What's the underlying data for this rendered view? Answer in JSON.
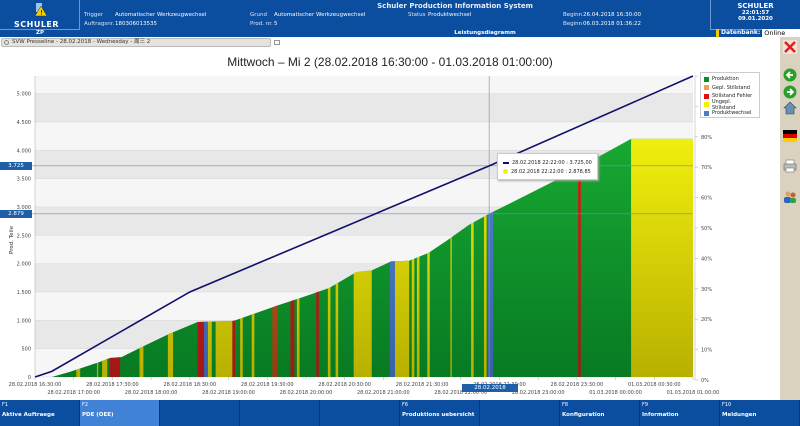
{
  "header": {
    "title": "Schuler Production Information System",
    "logo": "SCHULER",
    "fields": [
      {
        "label": "Trigger",
        "value": "Automatischer Werkzeugwechsel"
      },
      {
        "label": "Auftragsnr.",
        "value": "180306013535"
      },
      {
        "label": "Grund",
        "value": "Automatischer Werkzeugwechsel"
      },
      {
        "label": "Prod. nr.",
        "value": "5"
      },
      {
        "label": "Status",
        "value": "Produktwechsel"
      },
      {
        "label": "Beginn",
        "value": "26.04.2018 16:30:00"
      },
      {
        "label": "Beginn",
        "value": "06.03.2018 01:36:22"
      }
    ],
    "right_logo": "SCHULER",
    "time": "22:01:57",
    "date": "09.01.2020",
    "zp": "ZP",
    "view": "Leistungsdiagramm",
    "db_label": "Datenbank:",
    "db_value": "Online"
  },
  "tab": {
    "label": "SVW Presseline - 28.02.2018 - Wednesday - 周三 2"
  },
  "chart_title": "Mittwoch – Mi 2  (28.02.2018 16:30:00 - 01.03.2018 01:00:00)",
  "legend": [
    {
      "name": "Produktion",
      "color": "#0a8f2a"
    },
    {
      "name": "Gepl. Stillstand",
      "color": "#f0a050"
    },
    {
      "name": "Stillstand Fehler",
      "color": "#e01010"
    },
    {
      "name": "Ungepl. Stillstand",
      "color": "#f5f000"
    },
    {
      "name": "Produktwechsel",
      "color": "#4a7fc8"
    }
  ],
  "tooltip": [
    {
      "text": "28.02.2018 22:22:00 : 3.725,00",
      "color": "#10106a"
    },
    {
      "text": "28.02.2018 22:22:00 : 2.878,85",
      "color": "#f5f000"
    }
  ],
  "crosshair": {
    "y1_label": "3.725",
    "y2_label": "2.879",
    "x_label": "28.02.2018 22:22:00"
  },
  "chart_data": {
    "type": "area",
    "ylabel": "Prod. Teile",
    "start": "28.02.2018 16:30",
    "end": "01.03.2018 01:00",
    "ylim": [
      0,
      5310
    ],
    "y2lim": [
      0,
      100
    ],
    "yticks": [
      "0",
      "500",
      "1.000",
      "1.500",
      "2.000",
      "2.500",
      "3.000",
      "3.500",
      "4.000",
      "4.500",
      "5.000"
    ],
    "ytick_values": [
      0,
      500,
      1000,
      1500,
      2000,
      2500,
      3000,
      3500,
      4000,
      4500,
      5000
    ],
    "y2ticks": [
      "0%",
      "10%",
      "20%",
      "30%",
      "40%",
      "50%",
      "60%",
      "70%",
      "80%",
      "90%",
      "100%"
    ],
    "xticks_row1": [
      "28.02.2018 16:30:00",
      "28.02.2018 17:30:00",
      "28.02.2018 18:30:00",
      "28.02.2018 19:30:00",
      "28.02.2018 20:30:00",
      "28.02.2018 21:30:00",
      "28.02.2018 22:30:00",
      "28.02.2018 23:30:00",
      "01.03.2018 00:30:00"
    ],
    "xticks_row2": [
      "28.02.2018 17:00:00",
      "28.02.2018 18:00:00",
      "28.02.2018 19:00:00",
      "28.02.2018 20:00:00",
      "28.02.2018 21:00:00",
      "28.02.2018 22:00:00",
      "28.02.2018 23:00:00",
      "01.03.2018 00:00:00",
      "01.03.2018 01:00:00"
    ],
    "target_line": [
      [
        "28.02.2018 16:30",
        0
      ],
      [
        "28.02.2018 16:43",
        100
      ],
      [
        "28.02.2018 18:30",
        1500
      ],
      [
        "28.02.2018 22:22",
        3725
      ],
      [
        "01.03.2018 01:00",
        5310
      ]
    ],
    "produced": [
      [
        "28.02.2018 16:30",
        0
      ],
      [
        "28.02.2018 16:43",
        0
      ],
      [
        "28.02.2018 16:57",
        90
      ],
      [
        "28.02.2018 17:20",
        265
      ],
      [
        "28.02.2018 17:28",
        335
      ],
      [
        "28.02.2018 17:37",
        350
      ],
      [
        "28.02.2018 17:51",
        510
      ],
      [
        "28.02.2018 18:14",
        760
      ],
      [
        "28.02.2018 18:36",
        970
      ],
      [
        "28.02.2018 19:04",
        990
      ],
      [
        "28.02.2018 19:39",
        1270
      ],
      [
        "28.02.2018 19:55",
        1390
      ],
      [
        "28.02.2018 20:18",
        1570
      ],
      [
        "28.02.2018 20:39",
        1850
      ],
      [
        "28.02.2018 20:51",
        1880
      ],
      [
        "28.02.2018 21:06",
        2040
      ],
      [
        "28.02.2018 21:20",
        2050
      ],
      [
        "28.02.2018 21:35",
        2190
      ],
      [
        "28.02.2018 21:50",
        2420
      ],
      [
        "28.02.2018 22:06",
        2680
      ],
      [
        "28.02.2018 22:22",
        2879
      ],
      [
        "28.02.2018 23:11",
        3440
      ],
      [
        "01.03.2018 00:12",
        4200
      ],
      [
        "01.03.2018 01:00",
        4200
      ]
    ],
    "states": [
      [
        "28.02.2018 17:02",
        "28.02.2018 17:05",
        "Ungepl. Stillstand"
      ],
      [
        "28.02.2018 17:18",
        "28.02.2018 17:19",
        "Ungepl. Stillstand"
      ],
      [
        "28.02.2018 17:22",
        "28.02.2018 17:26",
        "Ungepl. Stillstand"
      ],
      [
        "28.02.2018 17:28",
        "28.02.2018 17:36",
        "Stillstand Fehler"
      ],
      [
        "28.02.2018 17:51",
        "28.02.2018 17:54",
        "Ungepl. Stillstand"
      ],
      [
        "28.02.2018 18:13",
        "28.02.2018 18:17",
        "Ungepl. Stillstand"
      ],
      [
        "28.02.2018 18:36",
        "28.02.2018 18:41",
        "Stillstand Fehler"
      ],
      [
        "28.02.2018 18:41",
        "28.02.2018 18:44",
        "Produktwechsel"
      ],
      [
        "28.02.2018 18:44",
        "28.02.2018 18:47",
        "Ungepl. Stillstand"
      ],
      [
        "28.02.2018 18:50",
        "28.02.2018 19:03",
        "Ungepl. Stillstand"
      ],
      [
        "28.02.2018 19:03",
        "28.02.2018 19:05",
        "Stillstand Fehler"
      ],
      [
        "28.02.2018 19:09",
        "28.02.2018 19:11",
        "Ungepl. Stillstand"
      ],
      [
        "28.02.2018 19:18",
        "28.02.2018 19:20",
        "Ungepl. Stillstand"
      ],
      [
        "28.02.2018 19:34",
        "28.02.2018 19:38",
        "Gepl. Stillstand"
      ],
      [
        "28.02.2018 19:48",
        "28.02.2018 19:51",
        "Stillstand Fehler"
      ],
      [
        "28.02.2018 19:53",
        "28.02.2018 19:55",
        "Ungepl. Stillstand"
      ],
      [
        "28.02.2018 20:08",
        "28.02.2018 20:10",
        "Stillstand Fehler"
      ],
      [
        "28.02.2018 20:17",
        "28.02.2018 20:19",
        "Ungepl. Stillstand"
      ],
      [
        "28.02.2018 20:23",
        "28.02.2018 20:25",
        "Ungepl. Stillstand"
      ],
      [
        "28.02.2018 20:37",
        "28.02.2018 20:51",
        "Ungepl. Stillstand"
      ],
      [
        "28.02.2018 21:05",
        "28.02.2018 21:09",
        "Produktwechsel"
      ],
      [
        "28.02.2018 21:09",
        "28.02.2018 21:20",
        "Ungepl. Stillstand"
      ],
      [
        "28.02.2018 21:22",
        "28.02.2018 21:24",
        "Ungepl. Stillstand"
      ],
      [
        "28.02.2018 21:26",
        "28.02.2018 21:28",
        "Ungepl. Stillstand"
      ],
      [
        "28.02.2018 21:34",
        "28.02.2018 21:36",
        "Ungepl. Stillstand"
      ],
      [
        "28.02.2018 21:52",
        "28.02.2018 21:53",
        "Ungepl. Stillstand"
      ],
      [
        "28.02.2018 22:08",
        "28.02.2018 22:10",
        "Ungepl. Stillstand"
      ],
      [
        "28.02.2018 22:18",
        "28.02.2018 22:20",
        "Ungepl. Stillstand"
      ],
      [
        "28.02.2018 22:21",
        "28.02.2018 22:25",
        "Produktwechsel"
      ],
      [
        "28.02.2018 23:31",
        "28.02.2018 23:33",
        "Stillstand Fehler"
      ],
      [
        "01.03.2018 00:12",
        "01.03.2018 01:00",
        "Ungepl. Stillstand"
      ]
    ]
  },
  "footer": [
    {
      "key": "F1",
      "label": "Aktive Auftraege"
    },
    {
      "key": "F2",
      "label": "PDE (OEE)",
      "active": true
    },
    {
      "key": "",
      "label": ""
    },
    {
      "key": "",
      "label": ""
    },
    {
      "key": "",
      "label": ""
    },
    {
      "key": "F6",
      "label": "Produktions uebersicht"
    },
    {
      "key": "",
      "label": ""
    },
    {
      "key": "F8",
      "label": "Konfiguration"
    },
    {
      "key": "F9",
      "label": "Information"
    },
    {
      "key": "F10",
      "label": "Meldungen"
    }
  ],
  "sidebar_icons": [
    "close-icon",
    "back-arrow-icon",
    "forward-arrow-icon",
    "home-icon",
    "german-flag-icon",
    "printer-icon",
    "users-icon"
  ]
}
